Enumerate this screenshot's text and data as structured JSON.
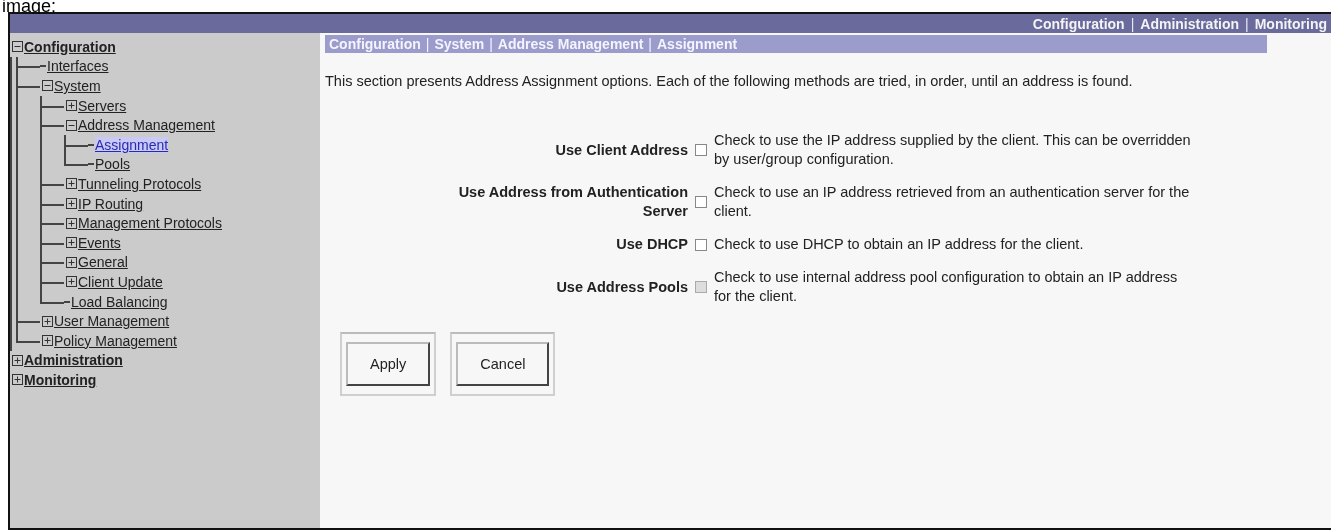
{
  "caption": "image:",
  "top_nav": [
    {
      "kind": "link",
      "label": "Configuration"
    },
    {
      "kind": "separator",
      "label": "|"
    },
    {
      "kind": "link",
      "label": "Administration"
    },
    {
      "kind": "separator",
      "label": "|"
    },
    {
      "kind": "link",
      "label": "Monitoring"
    }
  ],
  "tree": [
    {
      "label": "Configuration",
      "expanded": true,
      "selected": false,
      "children": [
        {
          "label": "Interfaces",
          "selected": false
        },
        {
          "label": "System",
          "expanded": true,
          "selected": false,
          "children": [
            {
              "label": "Servers",
              "expanded": false,
              "selected": false
            },
            {
              "label": "Address Management",
              "expanded": true,
              "selected": false,
              "children": [
                {
                  "label": "Assignment",
                  "selected": true
                },
                {
                  "label": "Pools",
                  "selected": false
                }
              ]
            },
            {
              "label": "Tunneling Protocols",
              "expanded": false,
              "selected": false
            },
            {
              "label": "IP Routing",
              "expanded": false,
              "selected": false
            },
            {
              "label": "Management Protocols",
              "expanded": false,
              "selected": false
            },
            {
              "label": "Events",
              "expanded": false,
              "selected": false
            },
            {
              "label": "General",
              "expanded": false,
              "selected": false
            },
            {
              "label": "Client Update",
              "expanded": false,
              "selected": false
            },
            {
              "label": "Load Balancing",
              "selected": false
            }
          ]
        },
        {
          "label": "User Management",
          "expanded": false,
          "selected": false
        },
        {
          "label": "Policy Management",
          "expanded": false,
          "selected": false
        }
      ]
    },
    {
      "label": "Administration",
      "expanded": false,
      "selected": false
    },
    {
      "label": "Monitoring",
      "expanded": false,
      "selected": false
    }
  ],
  "breadcrumb": [
    {
      "kind": "item",
      "label": "Configuration"
    },
    {
      "kind": "separator",
      "label": "|"
    },
    {
      "kind": "item",
      "label": "System"
    },
    {
      "kind": "separator",
      "label": "|"
    },
    {
      "kind": "item",
      "label": "Address Management"
    },
    {
      "kind": "separator",
      "label": "|"
    },
    {
      "kind": "item",
      "label": "Assignment"
    }
  ],
  "intro": "This section presents Address Assignment options. Each of the following methods are tried, in order, until an address is found.",
  "options": [
    {
      "label": "Use Client Address",
      "checked": false,
      "disabled": false,
      "help": "Check to use the IP address supplied by the client. This can be overridden by user/group configuration."
    },
    {
      "label": "Use Address from Authentication Server",
      "checked": false,
      "disabled": false,
      "help": "Check to use an IP address retrieved from an authentication server for the client."
    },
    {
      "label": "Use DHCP",
      "checked": false,
      "disabled": false,
      "help": "Check to use DHCP to obtain an IP address for the client."
    },
    {
      "label": "Use Address Pools",
      "checked": false,
      "disabled": true,
      "help": "Check to use internal address pool configuration to obtain an IP address for the client."
    }
  ],
  "buttons": [
    {
      "label": "Apply"
    },
    {
      "label": "Cancel"
    }
  ]
}
